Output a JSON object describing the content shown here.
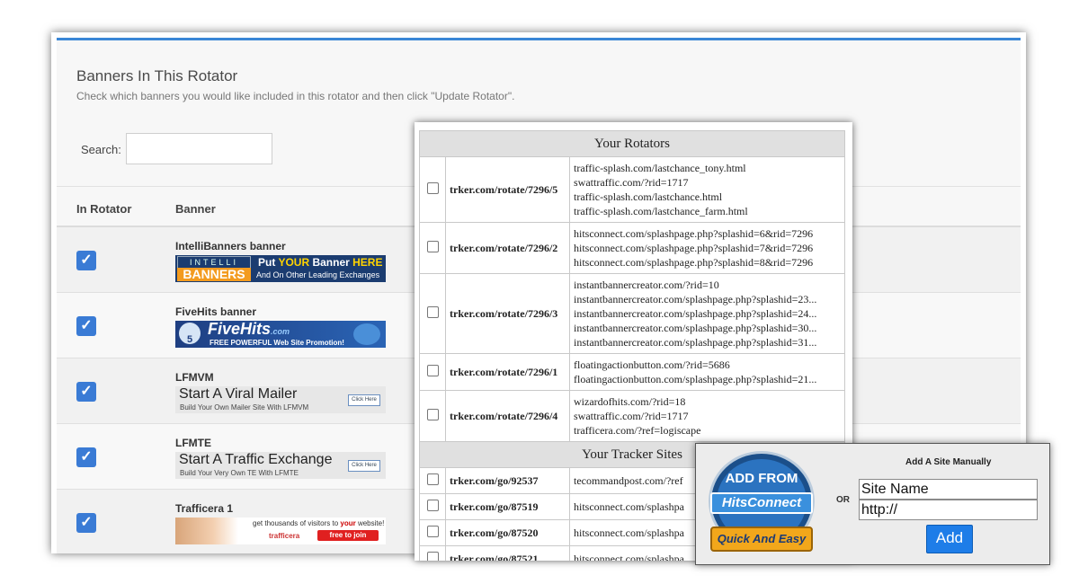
{
  "main": {
    "title": "Banners In This Rotator",
    "description": "Check which banners you would like included in this rotator and then click \"Update Rotator\".",
    "search_label": "Search:",
    "search_value": "",
    "columns": [
      "In Rotator",
      "Banner"
    ],
    "banners": [
      {
        "name": "IntelliBanners banner",
        "checked": true,
        "art": {
          "line1": "INTELLI",
          "line2": "BANNERS",
          "text_a": "Put ",
          "text_b": "YOUR",
          "text_c": " Banner ",
          "text_d": "HERE",
          "text_e": "And On Other Leading Exchanges"
        }
      },
      {
        "name": "FiveHits banner",
        "checked": true,
        "art": {
          "logo": "FiveHits",
          "logo_suffix": ".com",
          "number": "5",
          "tagline": "FREE POWERFUL Web Site Promotion!"
        }
      },
      {
        "name": "LFMVM",
        "checked": true,
        "art": {
          "headline": "Start A Viral Mailer",
          "sub": "Build Your Own Mailer Site With LFMVM",
          "button": "Click Here"
        }
      },
      {
        "name": "LFMTE",
        "checked": true,
        "art": {
          "headline": "Start A Traffic Exchange",
          "sub": "Build Your Very Own TE With LFMTE",
          "button": "Click Here"
        }
      },
      {
        "name": "Trafficera 1",
        "checked": true,
        "art": {
          "text_a": "get thousands of visitors to ",
          "text_b": "your",
          "text_c": " website!",
          "logo": "trafficera",
          "button": "free to join"
        }
      }
    ],
    "checkmark_icon": "✓"
  },
  "rotators_popup": {
    "rotators_header": "Your Rotators",
    "rotators": [
      {
        "link": "trker.com/rotate/7296/5",
        "sites": [
          "traffic-splash.com/lastchance_tony.html",
          "swattraffic.com/?rid=1717",
          "traffic-splash.com/lastchance.html",
          "traffic-splash.com/lastchance_farm.html"
        ]
      },
      {
        "link": "trker.com/rotate/7296/2",
        "sites": [
          "hitsconnect.com/splashpage.php?splashid=6&rid=7296",
          "hitsconnect.com/splashpage.php?splashid=7&rid=7296",
          "hitsconnect.com/splashpage.php?splashid=8&rid=7296"
        ]
      },
      {
        "link": "trker.com/rotate/7296/3",
        "sites": [
          "instantbannercreator.com/?rid=10",
          "instantbannercreator.com/splashpage.php?splashid=23...",
          "instantbannercreator.com/splashpage.php?splashid=24...",
          "instantbannercreator.com/splashpage.php?splashid=30...",
          "instantbannercreator.com/splashpage.php?splashid=31..."
        ]
      },
      {
        "link": "trker.com/rotate/7296/1",
        "sites": [
          "floatingactionbutton.com/?rid=5686",
          "floatingactionbutton.com/splashpage.php?splashid=21..."
        ]
      },
      {
        "link": "trker.com/rotate/7296/4",
        "sites": [
          "wizardofhits.com/?rid=18",
          "swattraffic.com/?rid=1717",
          "trafficera.com/?ref=logiscape"
        ]
      }
    ],
    "trackers_header": "Your Tracker Sites",
    "trackers": [
      {
        "link": "trker.com/go/92537",
        "site": "tecommandpost.com/?ref"
      },
      {
        "link": "trker.com/go/87519",
        "site": "hitsconnect.com/splashpa"
      },
      {
        "link": "trker.com/go/87520",
        "site": "hitsconnect.com/splashpa"
      },
      {
        "link": "trker.com/go/87521",
        "site": "hitsconnect.com/splashpa"
      }
    ]
  },
  "add_popup": {
    "badge_top": "ADD FROM",
    "badge_brand": "HitsConnect",
    "badge_ribbon": "Quick And Easy",
    "or_label": "OR",
    "title": "Add A Site Manually",
    "name_value": "Site Name",
    "url_value": "http://",
    "add_button": "Add"
  },
  "colors": {
    "accent": "#3a86d6",
    "checkbox": "#3a7bd5",
    "add_button": "#1e7de8"
  }
}
